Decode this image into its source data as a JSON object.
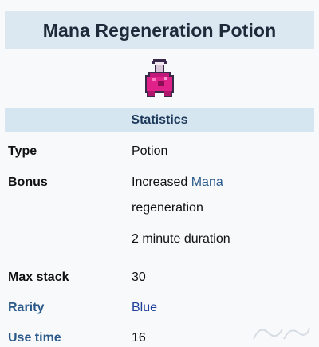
{
  "title": "Mana Regeneration Potion",
  "item_icon": "mana-regeneration-potion-icon",
  "section_header": "Statistics",
  "rows": {
    "type": {
      "label": "Type",
      "value": "Potion"
    },
    "bonus": {
      "label": "Bonus",
      "value_prefix": "Increased ",
      "value_link": "Mana",
      "value_line2": "regeneration",
      "value_line3": "2 minute duration"
    },
    "max_stack": {
      "label": "Max stack",
      "value": "30"
    },
    "rarity": {
      "label": "Rarity",
      "value": "Blue"
    },
    "use_time": {
      "label": "Use time",
      "value": "16"
    }
  },
  "colors": {
    "title_bg": "#dbe7f1",
    "section_bg": "#d6e6f1",
    "link": "#2b5a8a",
    "rarity_blue": "#1f3f9a",
    "potion_pink": "#e0218a"
  }
}
